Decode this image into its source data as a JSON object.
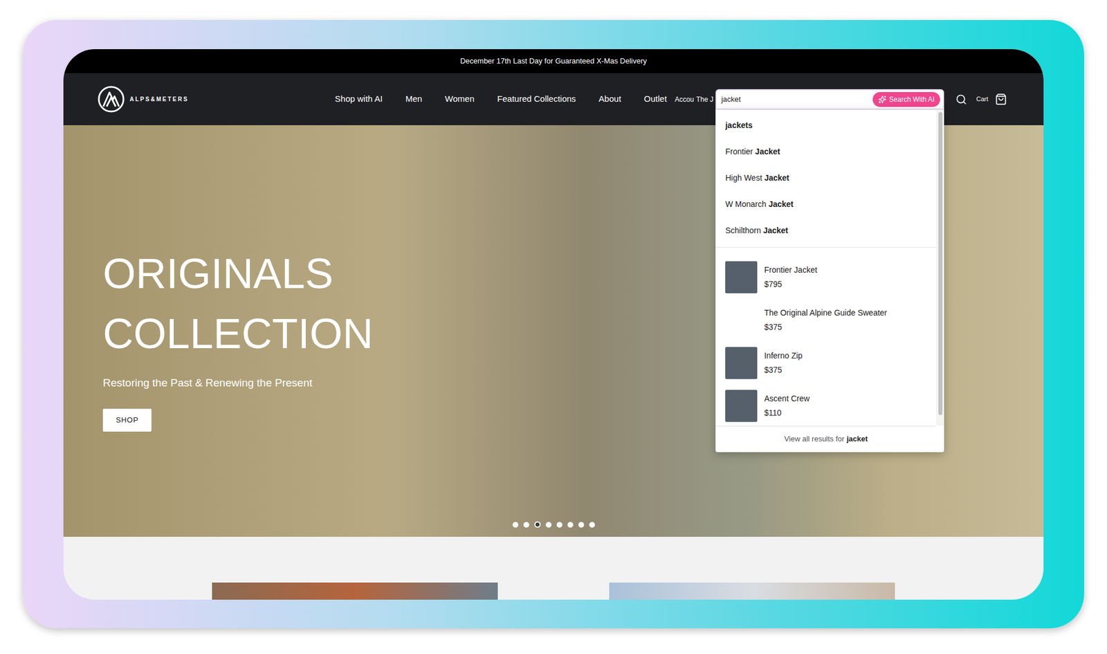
{
  "announcement": "December 17th Last Day for Guaranteed X-Mas Delivery",
  "brand": {
    "name": "ALPS&METERS"
  },
  "nav": {
    "links": [
      "Shop with AI",
      "Men",
      "Women",
      "Featured Collections",
      "About",
      "Outlet"
    ],
    "clipped": [
      "Accou",
      "The J"
    ]
  },
  "search": {
    "value": "jacket",
    "ai_button": "Search With AI"
  },
  "cart": {
    "label": "Cart"
  },
  "search_results": {
    "suggestions": [
      {
        "parts": [
          {
            "text": "jacket",
            "bold": true
          },
          {
            "text": "s",
            "bold": true
          }
        ]
      },
      {
        "parts": [
          {
            "text": "Frontier ",
            "bold": false
          },
          {
            "text": "Jacket",
            "bold": true
          }
        ]
      },
      {
        "parts": [
          {
            "text": "High West ",
            "bold": false
          },
          {
            "text": "Jacket",
            "bold": true
          }
        ]
      },
      {
        "parts": [
          {
            "text": "W Monarch ",
            "bold": false
          },
          {
            "text": "Jacket",
            "bold": true
          }
        ]
      },
      {
        "parts": [
          {
            "text": "Schilthorn ",
            "bold": false
          },
          {
            "text": "Jacket",
            "bold": true
          }
        ]
      }
    ],
    "products": [
      {
        "name": "Frontier Jacket",
        "price": "$795",
        "image": true
      },
      {
        "name": "The Original Alpine Guide Sweater",
        "price": "$375",
        "image": false
      },
      {
        "name": "Inferno Zip",
        "price": "$375",
        "image": true
      },
      {
        "name": "Ascent Crew",
        "price": "$110",
        "image": true
      }
    ],
    "view_all": {
      "prefix": "View all results for",
      "query": "jacket"
    }
  },
  "hero": {
    "title_lines": [
      "ORIGINALS",
      "COLLECTION"
    ],
    "subtitle": "Restoring the Past & Renewing the Present",
    "button": "SHOP",
    "slides": [
      {
        "selected": false
      },
      {
        "selected": false
      },
      {
        "selected": true
      },
      {
        "selected": false
      },
      {
        "selected": false
      },
      {
        "selected": false
      },
      {
        "selected": false
      },
      {
        "selected": false
      }
    ]
  }
}
